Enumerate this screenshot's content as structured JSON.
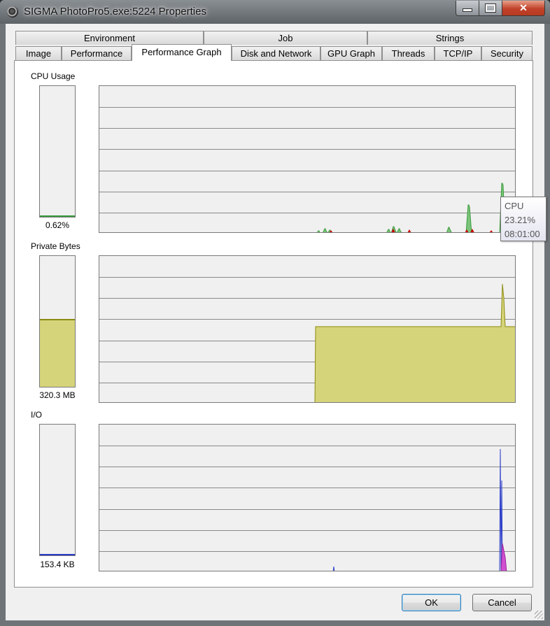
{
  "window": {
    "title": "SIGMA PhotoPro5.exe:5224 Properties"
  },
  "tabs": {
    "row_back": [
      {
        "label": "Environment"
      },
      {
        "label": "Job"
      },
      {
        "label": "Strings"
      }
    ],
    "row_front": [
      {
        "label": "Image"
      },
      {
        "label": "Performance"
      },
      {
        "label": "Performance Graph",
        "active": true
      },
      {
        "label": "Disk and Network"
      },
      {
        "label": "GPU Graph"
      },
      {
        "label": "Threads"
      },
      {
        "label": "TCP/IP"
      },
      {
        "label": "Security"
      }
    ]
  },
  "cpu": {
    "label": "CPU Usage",
    "value": "0.62%",
    "meter_fraction": 0.0062,
    "color": "#3a9a3a",
    "kernel_color": "#cc0000"
  },
  "private_bytes": {
    "label": "Private Bytes",
    "value": "320.3 MB",
    "meter_fraction": 0.51,
    "color": "#d6d47a",
    "line_color": "#8c8a10"
  },
  "io": {
    "label": "I/O",
    "value": "153.4  KB",
    "meter_fraction": 0.01,
    "color": "#2a3cc8",
    "other_color": "#d050d0"
  },
  "tooltip": {
    "series": "CPU",
    "value": "23.21%",
    "time": "08:01:00"
  },
  "buttons": {
    "ok": "OK",
    "cancel": "Cancel"
  }
}
